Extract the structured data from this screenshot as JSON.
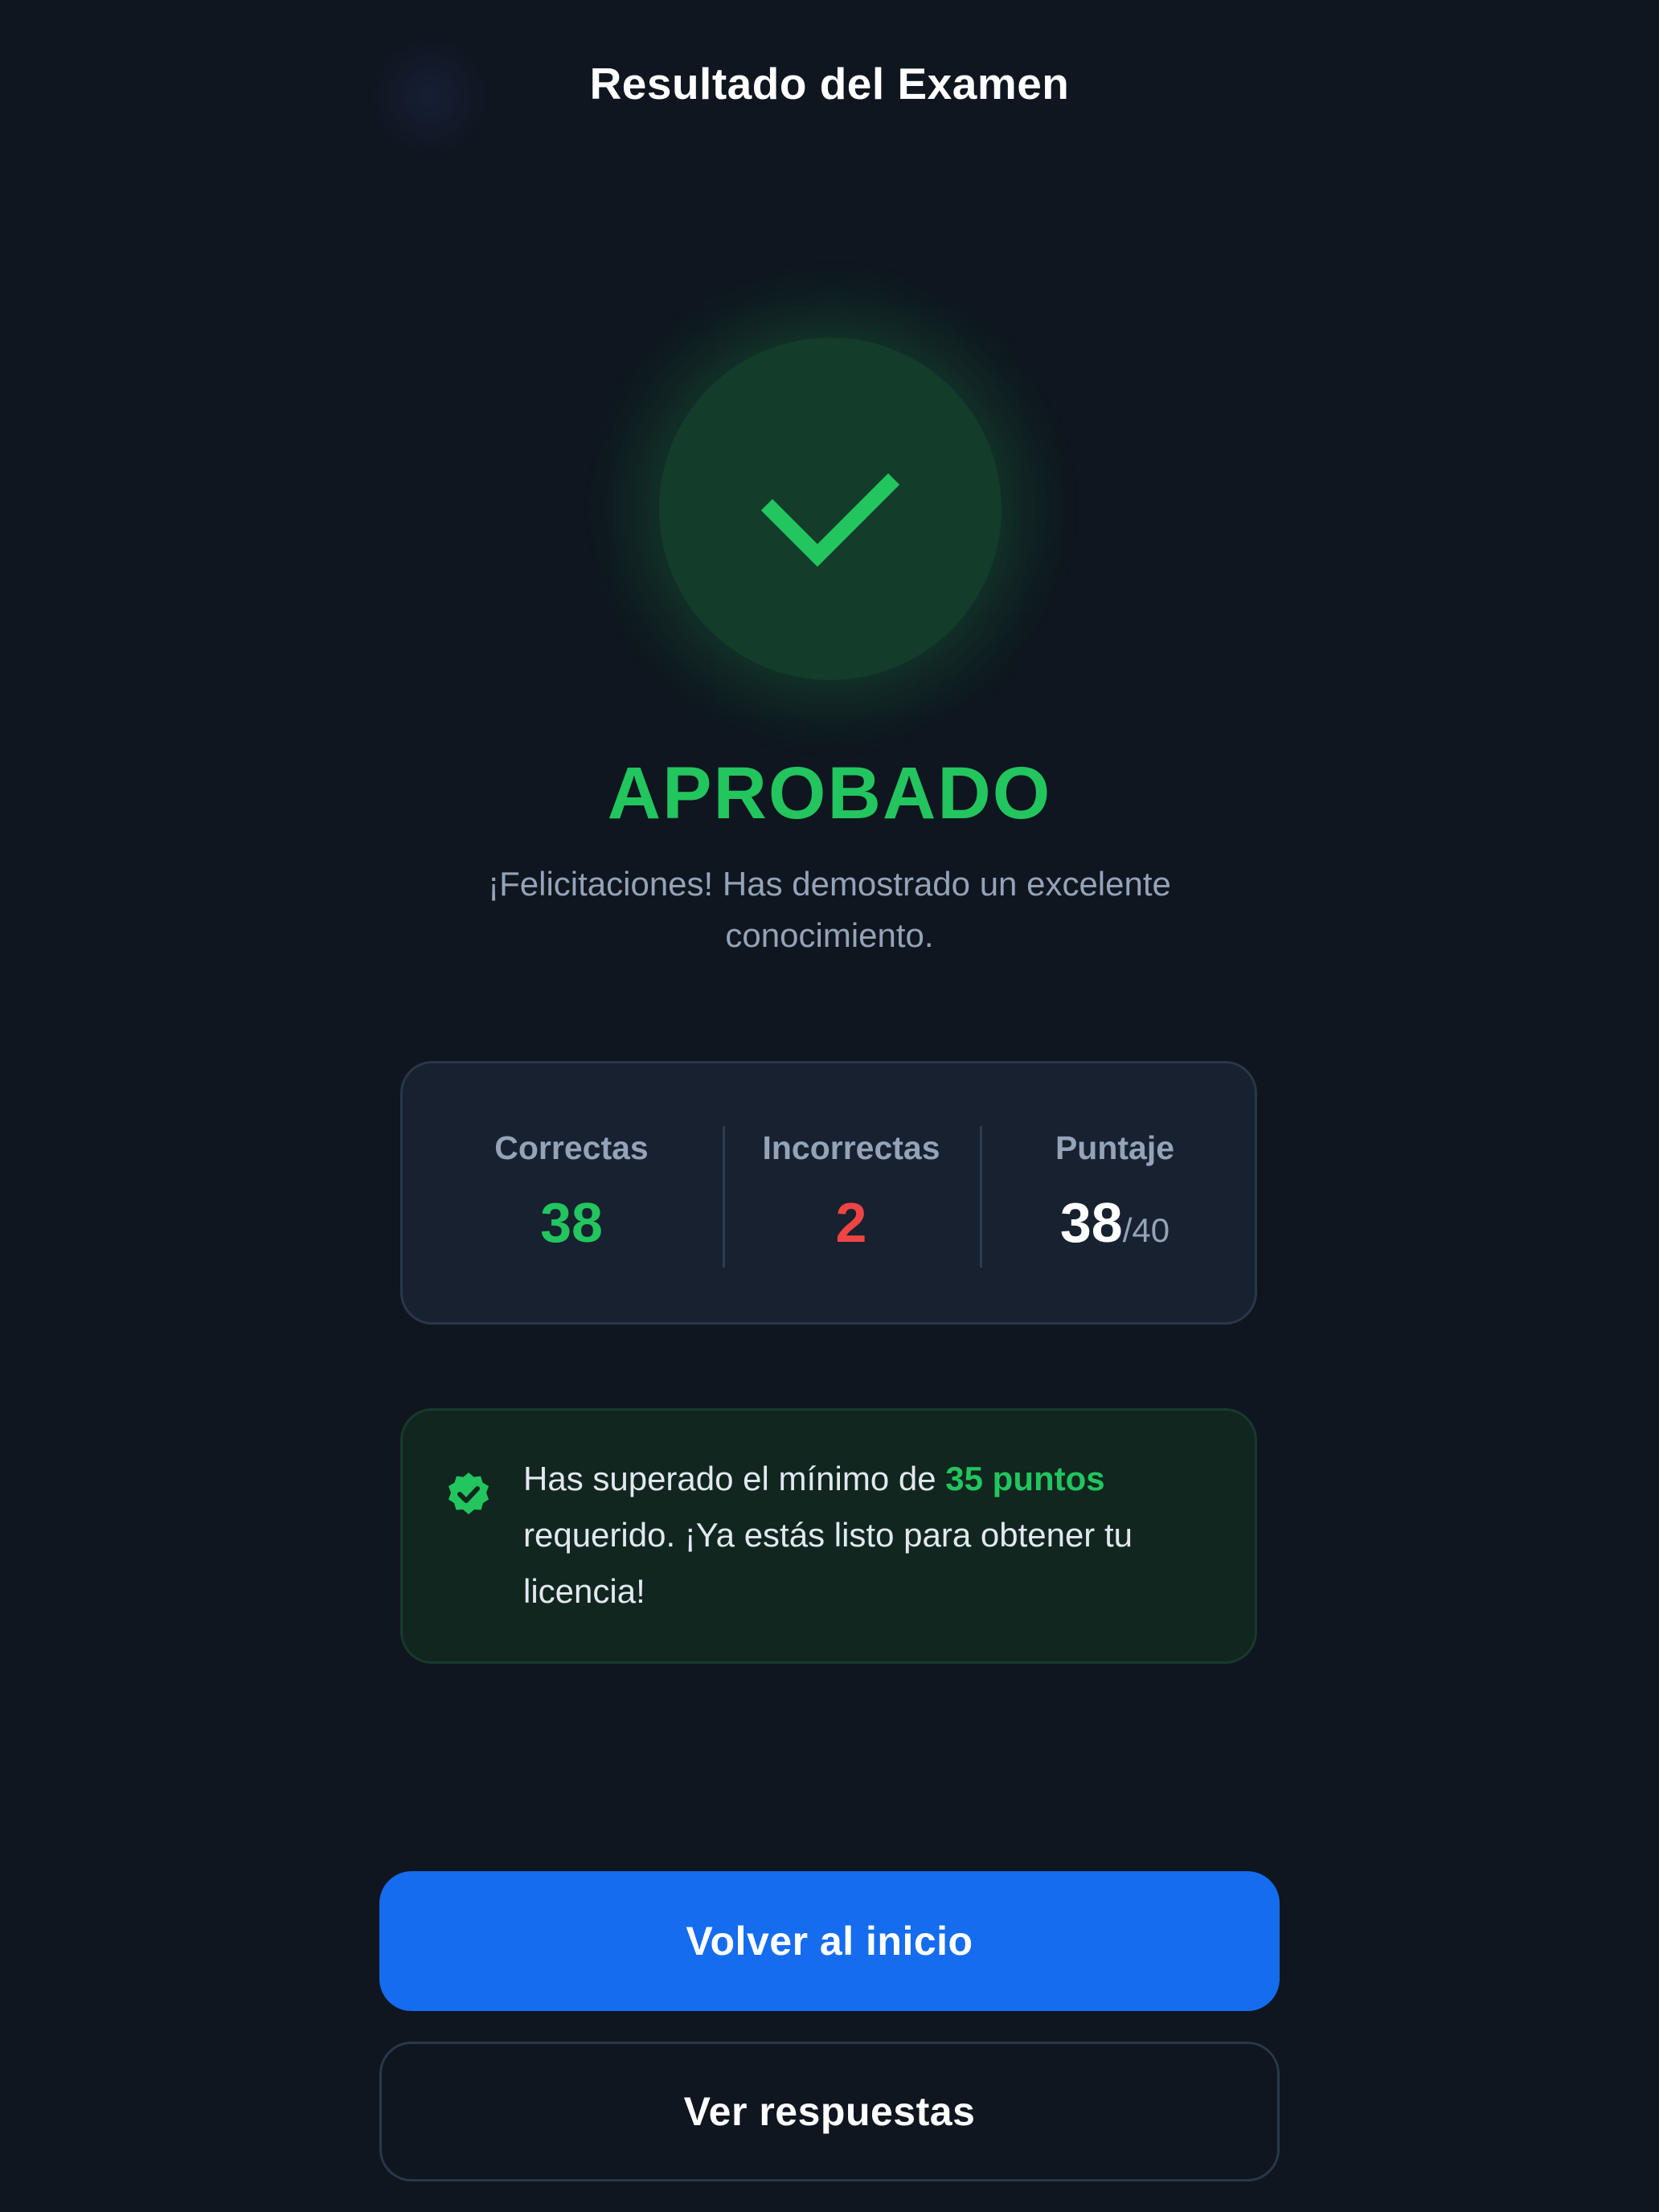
{
  "header": {
    "title": "Resultado del Examen"
  },
  "result": {
    "status": "APROBADO",
    "message": "¡Felicitaciones! Has demostrado un excelente conocimiento.",
    "icon": "checkmark-icon"
  },
  "stats": {
    "correct": {
      "label": "Correctas",
      "value": "38"
    },
    "incorrect": {
      "label": "Incorrectas",
      "value": "2"
    },
    "score": {
      "label": "Puntaje",
      "value": "38",
      "total": "/40"
    }
  },
  "info": {
    "icon": "verified-badge-icon",
    "text_before": "Has superado el mínimo de ",
    "highlight": "35 puntos",
    "text_after": " requerido. ¡Ya estás listo para obtener tu licencia!"
  },
  "actions": {
    "home_label": "Volver al inicio",
    "answers_label": "Ver respuestas"
  },
  "colors": {
    "background": "#0f161f",
    "success": "#22c55e",
    "error": "#ef4444",
    "primary": "#156cee",
    "muted": "#94a3b8"
  }
}
